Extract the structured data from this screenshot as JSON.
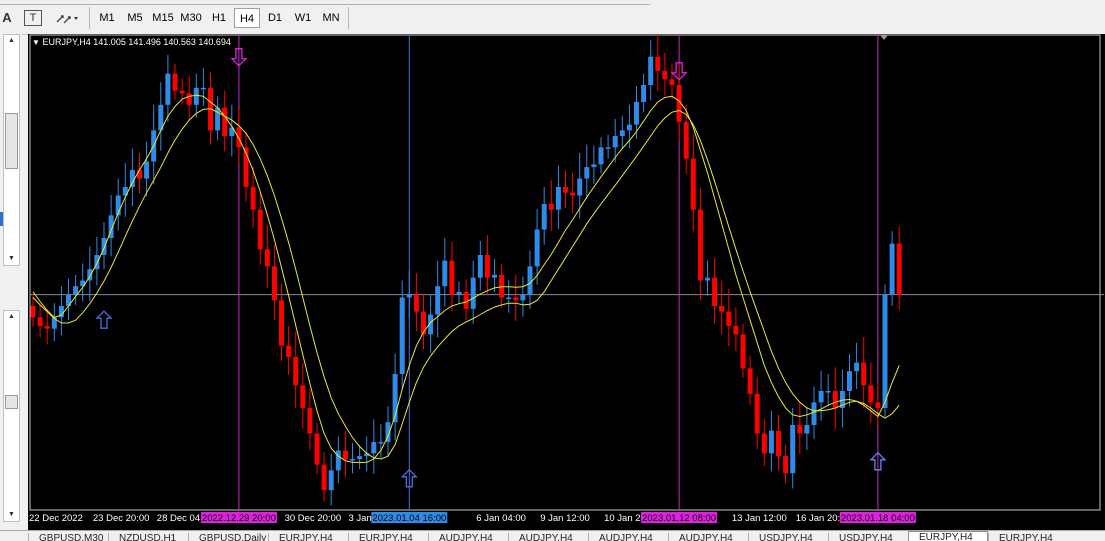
{
  "toolbar": {
    "text_tool_label": "A",
    "text_label_tool_label": "T",
    "timeframes": [
      {
        "label": "M1",
        "active": false
      },
      {
        "label": "M5",
        "active": false
      },
      {
        "label": "M15",
        "active": false
      },
      {
        "label": "M30",
        "active": false
      },
      {
        "label": "H1",
        "active": false
      },
      {
        "label": "H4",
        "active": true
      },
      {
        "label": "D1",
        "active": false
      },
      {
        "label": "W1",
        "active": false
      },
      {
        "label": "MN",
        "active": false
      }
    ]
  },
  "chart": {
    "header": "EURJPY,H4  141.005 141.496 140.563 140.694",
    "colors": {
      "background": "#000000",
      "bull": "#2f8be8",
      "bear": "#ff0000",
      "ema": "#e8e830",
      "vline_blue": "#4a6fe0",
      "vline_magenta": "#c030c0",
      "hline": "#8a8a9a",
      "axis_text": "#ffffff"
    }
  },
  "chart_data": {
    "type": "candlestick",
    "symbol": "EURJPY",
    "timeframe": "H4",
    "ohlc_header": {
      "open": 141.005,
      "high": 141.496,
      "low": 140.563,
      "close": 140.694
    },
    "ylim": [
      137.2,
      145.6
    ],
    "x_tick_labels": [
      "22 Dec 2022",
      "23 Dec 20:00",
      "28 Dec 04:00",
      "30 Dec 20:00",
      "3 Jan 12:00",
      "6 Jan 04:00",
      "9 Jan 12:00",
      "10 Jan 20:00",
      "13 Jan 12:00",
      "16 Jan 20:00"
    ],
    "x_tick_indices": [
      0,
      9,
      18,
      36,
      45,
      63,
      72,
      81,
      99,
      108
    ],
    "highlighted_labels": [
      {
        "label": "2022.12.29 20:00",
        "index": 29,
        "color": "#e020e0"
      },
      {
        "label": "2023.01.04 16:00",
        "index": 53,
        "color": "#2f8be8"
      },
      {
        "label": "2023.01.12 08:00",
        "index": 91,
        "color": "#e020e0"
      },
      {
        "label": "2023.01.18 04:00",
        "index": 119,
        "color": "#e020e0"
      }
    ],
    "vertical_lines": [
      {
        "index": 29,
        "color": "magenta"
      },
      {
        "index": 53,
        "color": "blue"
      },
      {
        "index": 91,
        "color": "magenta"
      },
      {
        "index": 119,
        "color": "magenta"
      }
    ],
    "horizontal_line": 141.0,
    "arrows": [
      {
        "index": 10,
        "price": 140.55,
        "direction": "up",
        "color": "#4a6fe0"
      },
      {
        "index": 29,
        "price": 145.2,
        "direction": "down",
        "color": "#e020e0"
      },
      {
        "index": 53,
        "price": 137.75,
        "direction": "up",
        "color": "#4a6fe0"
      },
      {
        "index": 91,
        "price": 144.95,
        "direction": "down",
        "color": "#e020e0"
      },
      {
        "index": 119,
        "price": 138.05,
        "direction": "up",
        "color": "#6a80ff"
      }
    ],
    "closes": [
      140.6,
      140.45,
      140.4,
      140.6,
      140.8,
      141.0,
      141.15,
      141.25,
      141.45,
      141.7,
      142.0,
      142.4,
      142.75,
      142.9,
      143.2,
      143.05,
      143.35,
      143.9,
      144.35,
      144.9,
      144.6,
      144.55,
      144.35,
      144.65,
      144.65,
      143.9,
      144.3,
      143.8,
      143.95,
      143.6,
      142.9,
      142.5,
      141.8,
      141.5,
      140.9,
      140.1,
      139.9,
      139.4,
      139.0,
      138.55,
      138.0,
      137.55,
      137.9,
      138.25,
      138.1,
      138.1,
      138.15,
      138.2,
      138.4,
      138.4,
      138.75,
      139.6,
      140.95,
      141.0,
      140.7,
      140.3,
      140.65,
      141.15,
      141.6,
      141.0,
      141.05,
      140.75,
      141.3,
      141.7,
      141.3,
      141.35,
      140.95,
      140.95,
      140.9,
      141.0,
      141.5,
      142.15,
      142.6,
      142.5,
      142.9,
      142.8,
      142.75,
      143.05,
      143.25,
      143.3,
      143.6,
      143.6,
      143.8,
      143.9,
      144.0,
      144.4,
      144.7,
      145.2,
      144.95,
      144.8,
      144.7,
      144.05,
      143.4,
      142.5,
      141.25,
      141.3,
      140.8,
      140.7,
      140.45,
      140.3,
      139.7,
      139.25,
      138.55,
      138.2,
      138.6,
      138.15,
      137.85,
      138.7,
      138.55,
      138.7,
      139.1,
      139.3,
      139.3,
      139.0,
      139.3,
      139.65,
      139.8,
      139.4,
      139.1,
      139.0,
      141.0,
      141.9,
      141.0
    ],
    "ema_fast": [
      141.05,
      140.88,
      140.72,
      140.6,
      140.64,
      140.8,
      140.97,
      141.13,
      141.32,
      141.55,
      141.82,
      142.13,
      142.44,
      142.72,
      142.98,
      143.2,
      143.4,
      143.63,
      143.9,
      144.15,
      144.32,
      144.45,
      144.5,
      144.52,
      144.5,
      144.4,
      144.3,
      144.15,
      143.97,
      143.76,
      143.5,
      143.19,
      142.82,
      142.41,
      141.97,
      141.48,
      140.98,
      140.46,
      139.94,
      139.43,
      138.95,
      138.55,
      138.29,
      138.15,
      138.07,
      138.04,
      138.04,
      138.04,
      138.1,
      138.25,
      138.5,
      138.86,
      139.33,
      139.75,
      140.1,
      140.34,
      140.51,
      140.61,
      140.72,
      140.8,
      140.84,
      140.87,
      140.94,
      141.01,
      141.07,
      141.12,
      141.14,
      141.14,
      141.13,
      141.14,
      141.2,
      141.34,
      141.53,
      141.71,
      141.92,
      142.14,
      142.32,
      142.52,
      142.72,
      142.9,
      143.08,
      143.25,
      143.42,
      143.58,
      143.72,
      143.88,
      144.06,
      144.25,
      144.4,
      144.48,
      144.5,
      144.42,
      144.25,
      143.95,
      143.55,
      143.15,
      142.7,
      142.25,
      141.8,
      141.35,
      140.95,
      140.55,
      140.15,
      139.75,
      139.45,
      139.2,
      139.0,
      138.88,
      138.85,
      138.88,
      138.93,
      138.98,
      139.05,
      139.1,
      139.14,
      139.15,
      139.12,
      139.05,
      138.95,
      138.85,
      139.1,
      139.45,
      139.75
    ],
    "ema_slow": [
      140.95,
      140.82,
      140.7,
      140.58,
      140.5,
      140.5,
      140.55,
      140.68,
      140.84,
      141.03,
      141.24,
      141.48,
      141.75,
      142.03,
      142.3,
      142.56,
      142.8,
      143.02,
      143.25,
      143.5,
      143.73,
      143.92,
      144.08,
      144.2,
      144.27,
      144.28,
      144.22,
      144.15,
      144.08,
      143.98,
      143.85,
      143.65,
      143.4,
      143.1,
      142.75,
      142.35,
      141.92,
      141.45,
      140.95,
      140.45,
      139.98,
      139.55,
      139.18,
      138.9,
      138.68,
      138.48,
      138.32,
      138.2,
      138.12,
      138.1,
      138.15,
      138.35,
      138.72,
      139.1,
      139.45,
      139.72,
      139.92,
      140.08,
      140.22,
      140.35,
      140.45,
      140.52,
      140.58,
      140.65,
      140.72,
      140.78,
      140.82,
      140.85,
      140.85,
      140.82,
      140.83,
      140.9,
      141.05,
      141.25,
      141.45,
      141.65,
      141.85,
      142.05,
      142.25,
      142.43,
      142.6,
      142.77,
      142.93,
      143.1,
      143.27,
      143.44,
      143.62,
      143.8,
      143.98,
      144.12,
      144.22,
      144.25,
      144.18,
      144.0,
      143.72,
      143.38,
      143.0,
      142.6,
      142.2,
      141.8,
      141.42,
      141.05,
      140.7,
      140.35,
      140.0,
      139.7,
      139.45,
      139.25,
      139.1,
      139.0,
      138.95,
      138.95,
      138.97,
      139.0,
      139.05,
      139.1,
      139.12,
      139.08,
      139.0,
      138.9,
      138.82,
      138.9,
      139.05
    ]
  },
  "tabs": [
    "GBPUSD,M30",
    "NZDUSD,H1",
    "GBPUSD,Daily",
    "EURJPY,H4",
    "EURJPY,H4",
    "AUDJPY,H4",
    "AUDJPY,H4",
    "AUDJPY,H4",
    "AUDJPY,H4",
    "USDJPY,H4",
    "USDJPY,H4",
    "EURJPY,H4",
    "EURJPY,H4"
  ]
}
